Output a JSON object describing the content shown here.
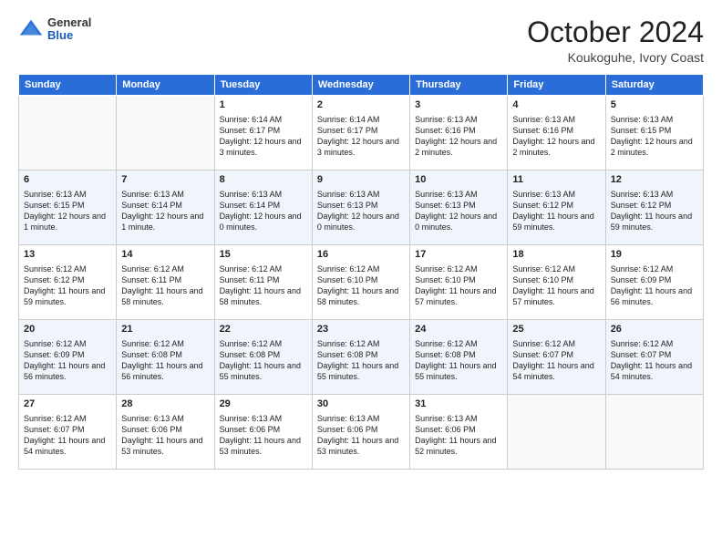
{
  "header": {
    "logo_general": "General",
    "logo_blue": "Blue",
    "month_title": "October 2024",
    "subtitle": "Koukoguhe, Ivory Coast"
  },
  "days_of_week": [
    "Sunday",
    "Monday",
    "Tuesday",
    "Wednesday",
    "Thursday",
    "Friday",
    "Saturday"
  ],
  "weeks": [
    [
      {
        "day": "",
        "sunrise": "",
        "sunset": "",
        "daylight": ""
      },
      {
        "day": "",
        "sunrise": "",
        "sunset": "",
        "daylight": ""
      },
      {
        "day": "1",
        "sunrise": "Sunrise: 6:14 AM",
        "sunset": "Sunset: 6:17 PM",
        "daylight": "Daylight: 12 hours and 3 minutes."
      },
      {
        "day": "2",
        "sunrise": "Sunrise: 6:14 AM",
        "sunset": "Sunset: 6:17 PM",
        "daylight": "Daylight: 12 hours and 3 minutes."
      },
      {
        "day": "3",
        "sunrise": "Sunrise: 6:13 AM",
        "sunset": "Sunset: 6:16 PM",
        "daylight": "Daylight: 12 hours and 2 minutes."
      },
      {
        "day": "4",
        "sunrise": "Sunrise: 6:13 AM",
        "sunset": "Sunset: 6:16 PM",
        "daylight": "Daylight: 12 hours and 2 minutes."
      },
      {
        "day": "5",
        "sunrise": "Sunrise: 6:13 AM",
        "sunset": "Sunset: 6:15 PM",
        "daylight": "Daylight: 12 hours and 2 minutes."
      }
    ],
    [
      {
        "day": "6",
        "sunrise": "Sunrise: 6:13 AM",
        "sunset": "Sunset: 6:15 PM",
        "daylight": "Daylight: 12 hours and 1 minute."
      },
      {
        "day": "7",
        "sunrise": "Sunrise: 6:13 AM",
        "sunset": "Sunset: 6:14 PM",
        "daylight": "Daylight: 12 hours and 1 minute."
      },
      {
        "day": "8",
        "sunrise": "Sunrise: 6:13 AM",
        "sunset": "Sunset: 6:14 PM",
        "daylight": "Daylight: 12 hours and 0 minutes."
      },
      {
        "day": "9",
        "sunrise": "Sunrise: 6:13 AM",
        "sunset": "Sunset: 6:13 PM",
        "daylight": "Daylight: 12 hours and 0 minutes."
      },
      {
        "day": "10",
        "sunrise": "Sunrise: 6:13 AM",
        "sunset": "Sunset: 6:13 PM",
        "daylight": "Daylight: 12 hours and 0 minutes."
      },
      {
        "day": "11",
        "sunrise": "Sunrise: 6:13 AM",
        "sunset": "Sunset: 6:12 PM",
        "daylight": "Daylight: 11 hours and 59 minutes."
      },
      {
        "day": "12",
        "sunrise": "Sunrise: 6:13 AM",
        "sunset": "Sunset: 6:12 PM",
        "daylight": "Daylight: 11 hours and 59 minutes."
      }
    ],
    [
      {
        "day": "13",
        "sunrise": "Sunrise: 6:12 AM",
        "sunset": "Sunset: 6:12 PM",
        "daylight": "Daylight: 11 hours and 59 minutes."
      },
      {
        "day": "14",
        "sunrise": "Sunrise: 6:12 AM",
        "sunset": "Sunset: 6:11 PM",
        "daylight": "Daylight: 11 hours and 58 minutes."
      },
      {
        "day": "15",
        "sunrise": "Sunrise: 6:12 AM",
        "sunset": "Sunset: 6:11 PM",
        "daylight": "Daylight: 11 hours and 58 minutes."
      },
      {
        "day": "16",
        "sunrise": "Sunrise: 6:12 AM",
        "sunset": "Sunset: 6:10 PM",
        "daylight": "Daylight: 11 hours and 58 minutes."
      },
      {
        "day": "17",
        "sunrise": "Sunrise: 6:12 AM",
        "sunset": "Sunset: 6:10 PM",
        "daylight": "Daylight: 11 hours and 57 minutes."
      },
      {
        "day": "18",
        "sunrise": "Sunrise: 6:12 AM",
        "sunset": "Sunset: 6:10 PM",
        "daylight": "Daylight: 11 hours and 57 minutes."
      },
      {
        "day": "19",
        "sunrise": "Sunrise: 6:12 AM",
        "sunset": "Sunset: 6:09 PM",
        "daylight": "Daylight: 11 hours and 56 minutes."
      }
    ],
    [
      {
        "day": "20",
        "sunrise": "Sunrise: 6:12 AM",
        "sunset": "Sunset: 6:09 PM",
        "daylight": "Daylight: 11 hours and 56 minutes."
      },
      {
        "day": "21",
        "sunrise": "Sunrise: 6:12 AM",
        "sunset": "Sunset: 6:08 PM",
        "daylight": "Daylight: 11 hours and 56 minutes."
      },
      {
        "day": "22",
        "sunrise": "Sunrise: 6:12 AM",
        "sunset": "Sunset: 6:08 PM",
        "daylight": "Daylight: 11 hours and 55 minutes."
      },
      {
        "day": "23",
        "sunrise": "Sunrise: 6:12 AM",
        "sunset": "Sunset: 6:08 PM",
        "daylight": "Daylight: 11 hours and 55 minutes."
      },
      {
        "day": "24",
        "sunrise": "Sunrise: 6:12 AM",
        "sunset": "Sunset: 6:08 PM",
        "daylight": "Daylight: 11 hours and 55 minutes."
      },
      {
        "day": "25",
        "sunrise": "Sunrise: 6:12 AM",
        "sunset": "Sunset: 6:07 PM",
        "daylight": "Daylight: 11 hours and 54 minutes."
      },
      {
        "day": "26",
        "sunrise": "Sunrise: 6:12 AM",
        "sunset": "Sunset: 6:07 PM",
        "daylight": "Daylight: 11 hours and 54 minutes."
      }
    ],
    [
      {
        "day": "27",
        "sunrise": "Sunrise: 6:12 AM",
        "sunset": "Sunset: 6:07 PM",
        "daylight": "Daylight: 11 hours and 54 minutes."
      },
      {
        "day": "28",
        "sunrise": "Sunrise: 6:13 AM",
        "sunset": "Sunset: 6:06 PM",
        "daylight": "Daylight: 11 hours and 53 minutes."
      },
      {
        "day": "29",
        "sunrise": "Sunrise: 6:13 AM",
        "sunset": "Sunset: 6:06 PM",
        "daylight": "Daylight: 11 hours and 53 minutes."
      },
      {
        "day": "30",
        "sunrise": "Sunrise: 6:13 AM",
        "sunset": "Sunset: 6:06 PM",
        "daylight": "Daylight: 11 hours and 53 minutes."
      },
      {
        "day": "31",
        "sunrise": "Sunrise: 6:13 AM",
        "sunset": "Sunset: 6:06 PM",
        "daylight": "Daylight: 11 hours and 52 minutes."
      },
      {
        "day": "",
        "sunrise": "",
        "sunset": "",
        "daylight": ""
      },
      {
        "day": "",
        "sunrise": "",
        "sunset": "",
        "daylight": ""
      }
    ]
  ]
}
